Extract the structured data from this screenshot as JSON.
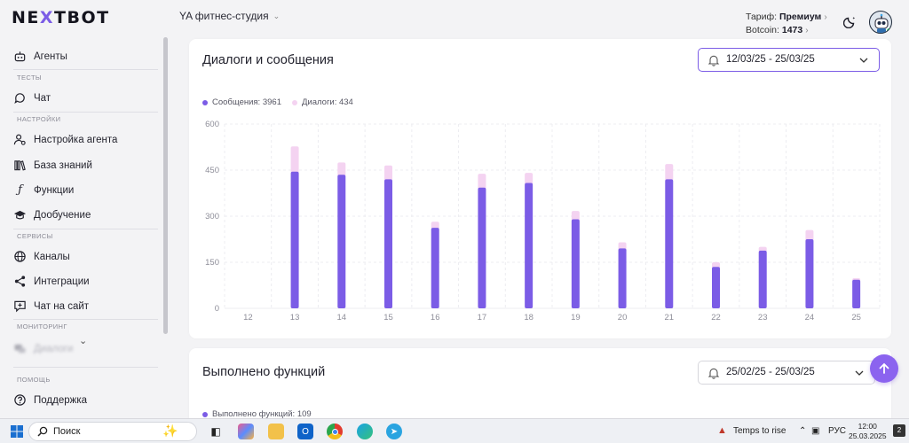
{
  "app": {
    "logo_part1": "NE",
    "logo_part2": "X",
    "logo_part3": "TBOT",
    "studio_name": "YA фитнес-студия",
    "plan_label": "Тариф:",
    "plan_value": "Премиум",
    "botcoin_label": "Botcoin:",
    "botcoin_value": "1473"
  },
  "sidebar": {
    "agents": "Агенты",
    "sec_tests": "ТЕСТЫ",
    "chat": "Чат",
    "sec_settings": "НАСТРОЙКИ",
    "agent_settings": "Настройка агента",
    "knowledge": "База знаний",
    "functions": "Функции",
    "training": "Дообучение",
    "sec_services": "СЕРВИСЫ",
    "channels": "Каналы",
    "integrations": "Интеграции",
    "site_chat": "Чат на сайт",
    "sec_monitoring": "МОНИТОРИНГ",
    "dialogs": "Диалоги",
    "sec_help": "ПОМОЩЬ",
    "support": "Поддержка"
  },
  "card1": {
    "title": "Диалоги и сообщения",
    "date_range": "12/03/25 - 25/03/25",
    "legend_messages": "Сообщения: 3961",
    "legend_dialogs": "Диалоги: 434"
  },
  "card2": {
    "title": "Выполнено функций",
    "date_range": "25/02/25 - 25/03/25",
    "legend_functions": "Выполнено функций: 109"
  },
  "taskbar": {
    "search_label": "Поиск",
    "weather": "Temps to rise",
    "lang": "РУС",
    "time": "12:00",
    "date": "25.03.2025",
    "notif_count": "2"
  },
  "colors": {
    "accent": "#7b5ce6",
    "messages": "#7b5ce6",
    "dialogs": "#f4d3f1",
    "fab": "#8b63ef"
  },
  "chart_data": {
    "type": "bar",
    "categories": [
      "12",
      "13",
      "14",
      "15",
      "16",
      "17",
      "18",
      "19",
      "20",
      "21",
      "22",
      "23",
      "24",
      "25"
    ],
    "stacked": true,
    "series": [
      {
        "name": "Сообщения",
        "color": "#7b5ce6",
        "values": [
          0,
          445,
          435,
          420,
          262,
          393,
          408,
          290,
          195,
          420,
          135,
          188,
          225,
          93
        ]
      },
      {
        "name": "Диалоги",
        "color": "#f4d3f1",
        "values": [
          0,
          82,
          40,
          45,
          20,
          45,
          33,
          27,
          20,
          50,
          15,
          12,
          30,
          5
        ]
      }
    ],
    "yticks": [
      0,
      150,
      300,
      450,
      600
    ],
    "ylim": [
      0,
      600
    ],
    "grid": true,
    "legend": "top-left"
  }
}
